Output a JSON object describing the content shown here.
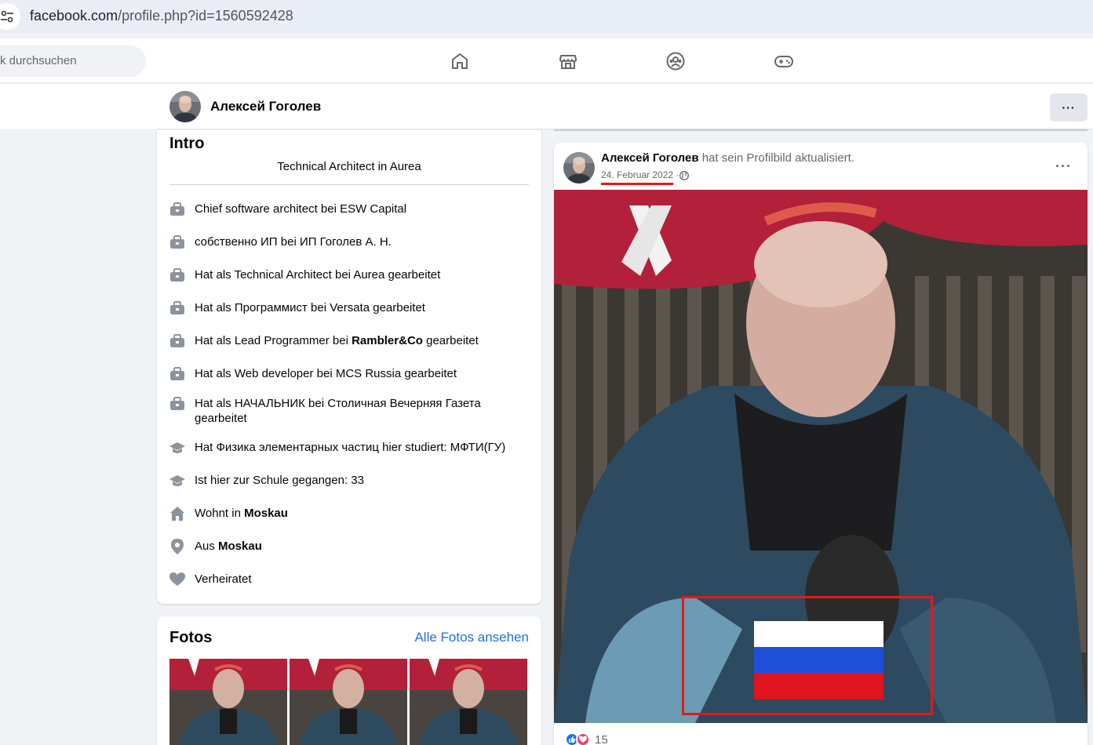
{
  "browser": {
    "url_domain": "facebook.com",
    "url_path": "/profile.php?id=1560592428"
  },
  "nav": {
    "search_placeholder": "k durchsuchen",
    "icons": [
      "home-icon",
      "marketplace-icon",
      "groups-icon",
      "gaming-icon"
    ]
  },
  "profile": {
    "name": "Алексей Гоголев",
    "more_label": "···"
  },
  "intro": {
    "title": "Intro",
    "bio": "Technical Architect in Aurea",
    "items": [
      {
        "icon": "work-icon",
        "text": "Chief software architect bei ESW Capital"
      },
      {
        "icon": "work-icon",
        "text": "собственно ИП bei ИП Гоголев А. Н."
      },
      {
        "icon": "work-icon",
        "text": "Hat als Technical Architect bei Aurea gearbeitet"
      },
      {
        "icon": "work-icon",
        "text": "Hat als Программист bei Versata gearbeitet"
      },
      {
        "icon": "work-icon",
        "pre": "Hat als Lead Programmer bei ",
        "bold": "Rambler&Co",
        "post": " gearbeitet"
      },
      {
        "icon": "work-icon",
        "text": "Hat als Web developer bei MCS Russia gearbeitet"
      },
      {
        "icon": "work-icon",
        "text": "Hat als НАЧАЛЬНИК bei Столичная Вечерняя Газета gearbeitet"
      },
      {
        "icon": "education-icon",
        "text": "Hat Физика элементарных частиц hier studiert: МФТИ(ГУ)"
      },
      {
        "icon": "education-icon",
        "text": "Ist hier zur Schule gegangen: 33"
      },
      {
        "icon": "home-icon",
        "pre": "Wohnt in ",
        "bold": "Moskau",
        "post": ""
      },
      {
        "icon": "location-icon",
        "pre": "Aus ",
        "bold": "Moskau",
        "post": ""
      },
      {
        "icon": "heart-icon",
        "text": "Verheiratet"
      }
    ]
  },
  "photos": {
    "title": "Fotos",
    "see_all": "Alle Fotos ansehen"
  },
  "post": {
    "author": "Алексей Гоголев",
    "action": " hat sein Profilbild aktualisiert.",
    "date": "24. Februar 2022",
    "date_sep": " · ",
    "more_label": "···",
    "reaction_count": "15",
    "colors": {
      "highlight": "#e01b1b",
      "like": "#1877f2",
      "love": "#f33e58"
    }
  }
}
